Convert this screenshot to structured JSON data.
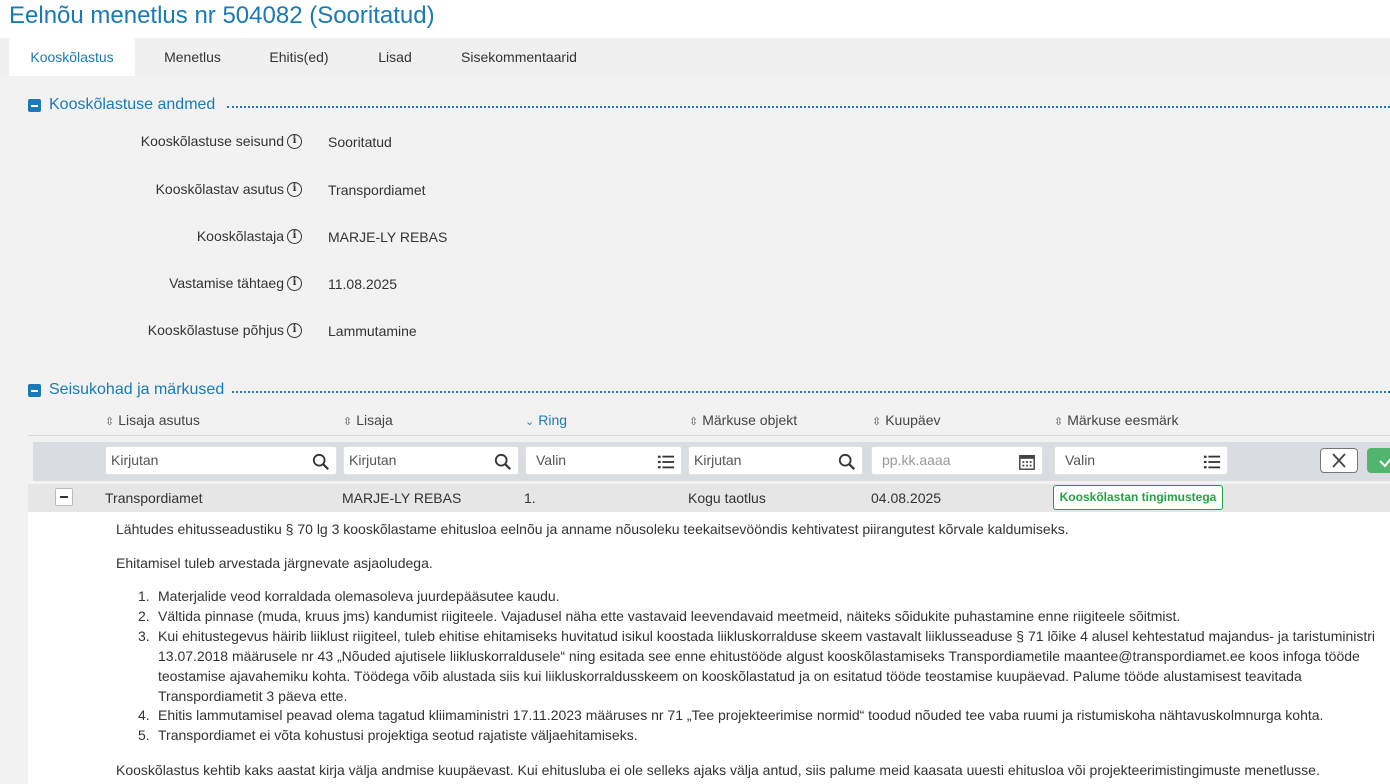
{
  "page": {
    "title": "Eelnõu menetlus nr 504082 (Sooritatud)"
  },
  "tabs": [
    {
      "label": "Kooskõlastus",
      "active": true
    },
    {
      "label": "Menetlus"
    },
    {
      "label": "Ehitis(ed)"
    },
    {
      "label": "Lisad"
    },
    {
      "label": "Sisekommentaarid"
    }
  ],
  "sections": {
    "data": {
      "title": "Kooskõlastuse andmed"
    },
    "remarks": {
      "title": "Seisukohad ja märkused"
    }
  },
  "fields": [
    {
      "label": "Kooskõlastuse seisund",
      "value": "Sooritatud"
    },
    {
      "label": "Kooskõlastav asutus",
      "value": "Transpordiamet"
    },
    {
      "label": "Kooskõlastaja",
      "value": "MARJE-LY REBAS"
    },
    {
      "label": "Vastamise tähtaeg",
      "value": "11.08.2025"
    },
    {
      "label": "Kooskõlastuse põhjus",
      "value": "Lammutamine"
    }
  ],
  "table": {
    "columns": [
      {
        "label": "Lisaja asutus",
        "sort_icon": "sort-both-icon"
      },
      {
        "label": "Lisaja",
        "sort_icon": "sort-both-icon"
      },
      {
        "label": "Ring",
        "sort_icon": "sort-desc-icon",
        "active": true
      },
      {
        "label": "Märkuse objekt",
        "sort_icon": "sort-both-icon"
      },
      {
        "label": "Kuupäev",
        "sort_icon": "sort-both-icon"
      },
      {
        "label": "Märkuse eesmärk",
        "sort_icon": "sort-both-icon"
      }
    ],
    "filters": [
      {
        "placeholder": "Kirjutan",
        "icon": "search-icon"
      },
      {
        "placeholder": "Kirjutan",
        "icon": "search-icon"
      },
      {
        "placeholder": "Valin",
        "icon": "list-icon"
      },
      {
        "placeholder": "Kirjutan",
        "icon": "search-icon"
      },
      {
        "placeholder": "pp.kk.aaaa",
        "icon": "calendar-icon"
      },
      {
        "placeholder": "Valin",
        "icon": "list-icon"
      }
    ],
    "rows": [
      {
        "institution": "Transpordiamet",
        "author": "MARJE-LY REBAS",
        "round": "1.",
        "object": "Kogu taotlus",
        "date": "04.08.2025",
        "purpose": "Kooskõlastan tingimustega",
        "purpose_color": "#1fa53f"
      }
    ],
    "detail": {
      "intro": "Lähtudes ehitusseadustiku § 70 lg 3 kooskõlastame ehitusloa eelnõu ja anname nõusoleku teekaitsevööndis kehtivatest piirangutest kõrvale kaldumiseks.",
      "lead": "Ehitamisel tuleb arvestada järgnevate asjaoludega.",
      "items": [
        {
          "num": "1.",
          "text": "Materjalide veod korraldada olemasoleva juurdepääsutee kaudu."
        },
        {
          "num": "2.",
          "text": "Vältida pinnase (muda, kruus jms) kandumist riigiteele. Vajadusel näha ette vastavaid leevendavaid meetmeid, näiteks sõidukite puhastamine enne riigiteele sõitmist."
        },
        {
          "num": "3.",
          "text": "Kui ehitustegevus häirib liiklust riigiteel, tuleb ehitise ehitamiseks huvitatud isikul koostada liikluskorralduse skeem vastavalt liiklusseaduse § 71 lõike 4 alusel kehtestatud majandus- ja taristuministri 13.07.2018 määrusele nr 43 „Nõuded ajutisele liikluskorraldusele“ ning esitada see enne ehitustööde algust kooskõlastamiseks Transpordiametile maantee@transpordiamet.ee koos infoga tööde teostamise ajavahemiku kohta. Töödega võib alustada siis kui liikluskorraldusskeem on kooskõlastatud ja on esitatud tööde teostamise kuupäevad. Palume tööde alustamisest teavitada Transpordiametit 3 päeva ette."
        },
        {
          "num": "4.",
          "text": "Ehitis lammutamisel peavad olema tagatud kliimaministri 17.11.2023 määruses nr 71 „Tee projekteerimise normid“ toodud nõuded tee vaba ruumi ja ristumiskoha nähtavuskolmnurga kohta."
        },
        {
          "num": "5.",
          "text": "Transpordiamet ei võta kohustusi projektiga seotud rajatiste väljaehitamiseks."
        }
      ],
      "closing": "Kooskõlastus kehtib kaks aastat kirja välja andmise kuupäevast. Kui ehitusluba ei ole selleks ajaks välja antud, siis palume meid kaasata uuesti ehitusloa või projekteerimistingimuste menetlusse."
    }
  },
  "colors": {
    "accent": "#1a7ab5",
    "success": "#1fa53f",
    "apply_button": "#52b56e"
  }
}
